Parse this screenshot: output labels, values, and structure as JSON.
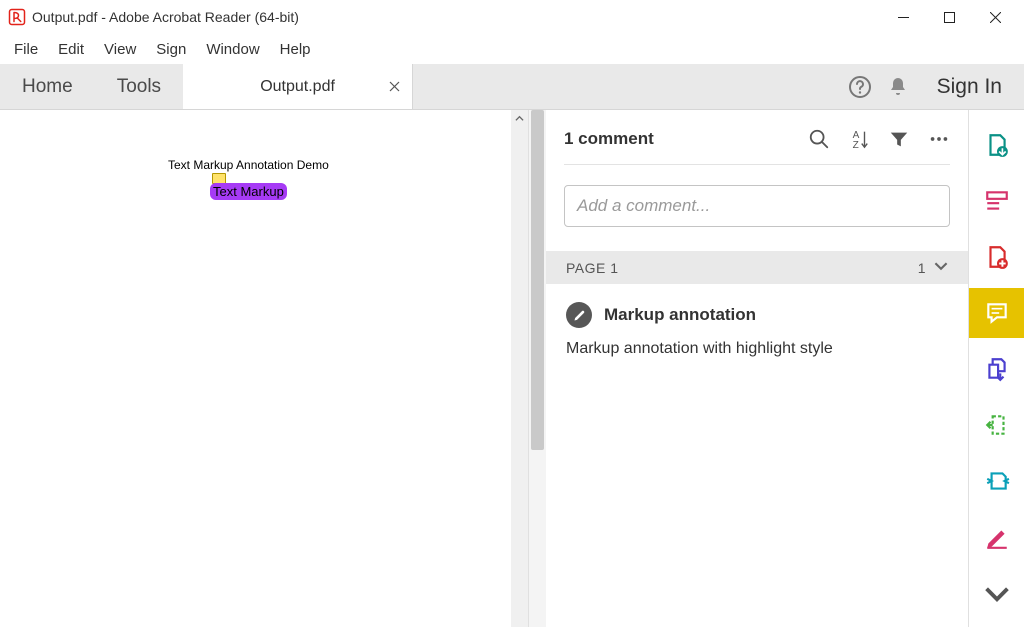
{
  "window": {
    "title": "Output.pdf - Adobe Acrobat Reader (64-bit)"
  },
  "menu": {
    "file": "File",
    "edit": "Edit",
    "view": "View",
    "sign": "Sign",
    "window": "Window",
    "help": "Help"
  },
  "main_tabs": {
    "home": "Home",
    "tools": "Tools",
    "doc_title": "Output.pdf",
    "signin": "Sign In"
  },
  "document": {
    "heading": "Text Markup Annotation Demo",
    "highlight_text": "Text Markup"
  },
  "comments": {
    "header": "1 comment",
    "add_placeholder": "Add a comment...",
    "page_label": "PAGE 1",
    "page_count": "1",
    "items": [
      {
        "title": "Markup annotation",
        "body": "Markup annotation with highlight style"
      }
    ]
  }
}
